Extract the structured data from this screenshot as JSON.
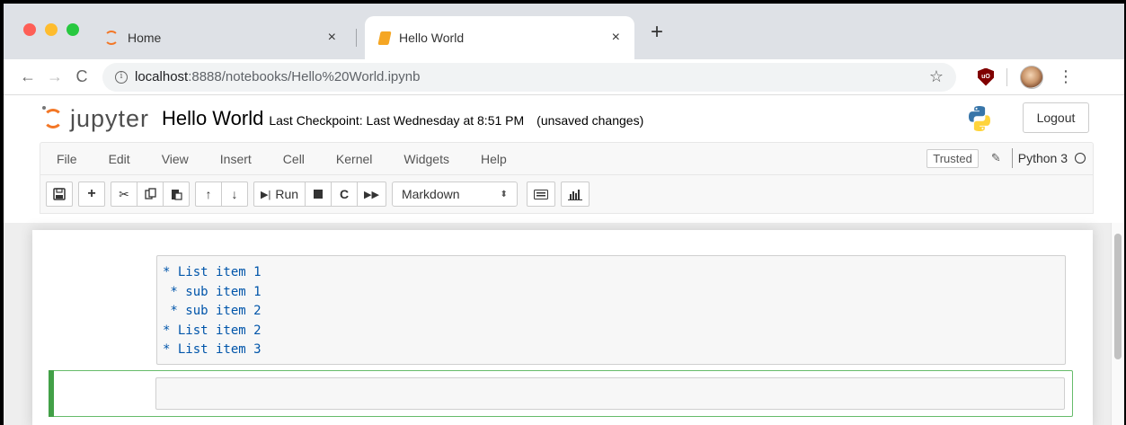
{
  "browser": {
    "tabs": [
      {
        "title": "Home",
        "icon": "jupyter-icon",
        "close": "×"
      },
      {
        "title": "Hello World",
        "icon": "notebook-book-icon",
        "close": "×"
      }
    ],
    "new_tab": "+",
    "url_host": "localhost",
    "url_path": ":8888/notebooks/Hello%20World.ipynb"
  },
  "jupyter": {
    "logo_text": "jupyter",
    "notebook_name": "Hello World",
    "checkpoint": "Last Checkpoint: Last Wednesday at 8:51 PM",
    "autosave": "(unsaved changes)",
    "logout": "Logout"
  },
  "menubar": {
    "items": [
      "File",
      "Edit",
      "View",
      "Insert",
      "Cell",
      "Kernel",
      "Widgets",
      "Help"
    ],
    "trusted": "Trusted",
    "kernel_name": "Python 3"
  },
  "toolbar": {
    "run_label": "Run",
    "cell_type": "Markdown"
  },
  "cells": {
    "markdown_lines": [
      "* List item 1",
      " * sub item 1",
      " * sub item 2",
      "* List item 2",
      "* List item 3"
    ]
  },
  "colors": {
    "jupyter_orange": "#f37726",
    "markdown_text": "#0055aa",
    "selected_cell": "#42a047"
  }
}
